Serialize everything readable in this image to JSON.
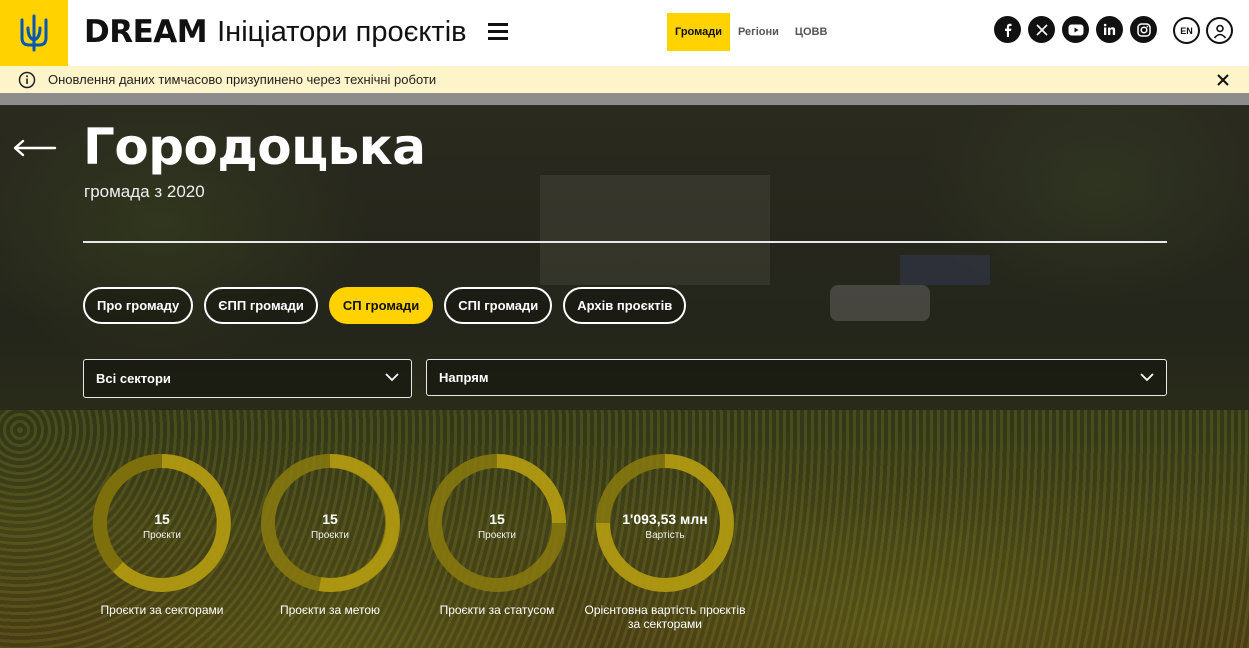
{
  "header": {
    "brand_bold": "DREAM",
    "brand_sub": "Ініціатори проєктів",
    "nav": [
      {
        "label": "Громади",
        "active": true
      },
      {
        "label": "Регіони",
        "active": false
      },
      {
        "label": "ЦОВВ",
        "active": false
      }
    ],
    "socials": [
      "facebook-icon",
      "x-icon",
      "youtube-icon",
      "linkedin-icon",
      "instagram-icon"
    ],
    "lang": "EN"
  },
  "notice": {
    "text": "Оновлення даних тимчасово призупинено через технічні роботи"
  },
  "hero": {
    "title": "Городоцька",
    "subtitle": "громада з 2020",
    "tabs": [
      {
        "label": "Про громаду",
        "active": false
      },
      {
        "label": "ЄПП громади",
        "active": false
      },
      {
        "label": "СП громади",
        "active": true
      },
      {
        "label": "СПІ громади",
        "active": false
      },
      {
        "label": "Архів проєктів",
        "active": false
      }
    ],
    "filters": {
      "sector": "Всі сектори",
      "direction": "Напрям"
    }
  },
  "stats": [
    {
      "value": "15",
      "unit": "Проєкти",
      "caption": "Проєкти за секторами"
    },
    {
      "value": "15",
      "unit": "Проєкти",
      "caption": "Проєкти за метою"
    },
    {
      "value": "15",
      "unit": "Проєкти",
      "caption": "Проєкти за статусом"
    },
    {
      "value": "1'093,53 млн",
      "unit": "Вартість",
      "caption": "Орієнтовна вартість проєктів за секторами"
    }
  ],
  "colors": {
    "accent": "#ffd200",
    "notice_bg": "#fdf4c9"
  }
}
